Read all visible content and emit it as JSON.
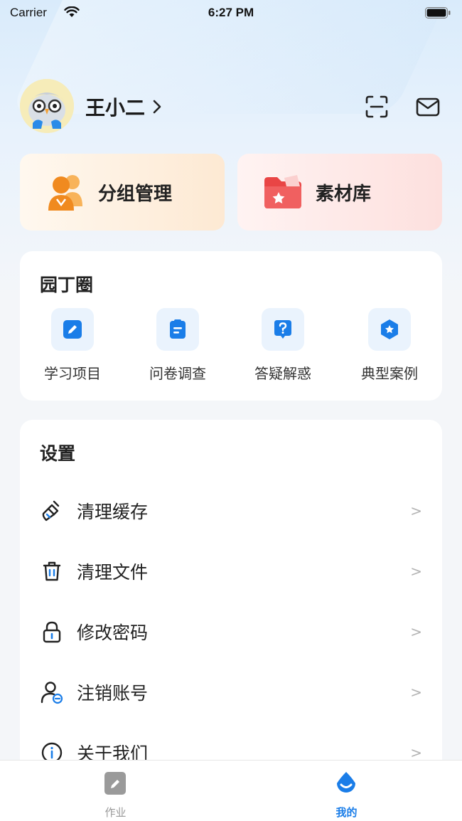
{
  "status_bar": {
    "carrier": "Carrier",
    "time": "6:27 PM"
  },
  "profile": {
    "name": "王小二",
    "chevron": "›"
  },
  "header_icons": {
    "scan": "scan-icon",
    "mail": "mail-icon"
  },
  "features": [
    {
      "label": "分组管理",
      "icon": "group-people-icon"
    },
    {
      "label": "素材库",
      "icon": "folder-star-icon"
    }
  ],
  "garden": {
    "title": "园丁圈",
    "items": [
      {
        "label": "学习项目",
        "icon": "pencil-icon"
      },
      {
        "label": "问卷调查",
        "icon": "clipboard-icon"
      },
      {
        "label": "答疑解惑",
        "icon": "question-bubble-icon"
      },
      {
        "label": "典型案例",
        "icon": "star-badge-icon"
      }
    ]
  },
  "settings": {
    "title": "设置",
    "items": [
      {
        "label": "清理缓存",
        "icon": "broom-icon",
        "arrow": ">"
      },
      {
        "label": "清理文件",
        "icon": "trash-icon",
        "arrow": ">"
      },
      {
        "label": "修改密码",
        "icon": "lock-icon",
        "arrow": ">"
      },
      {
        "label": "注销账号",
        "icon": "user-cancel-icon",
        "arrow": ">"
      },
      {
        "label": "关于我们",
        "icon": "info-icon",
        "arrow": ">"
      }
    ]
  },
  "tabbar": {
    "tabs": [
      {
        "label": "作业",
        "active": false
      },
      {
        "label": "我的",
        "active": true
      }
    ]
  },
  "colors": {
    "accent": "#1a7de8",
    "background": "#f4f6f9"
  }
}
